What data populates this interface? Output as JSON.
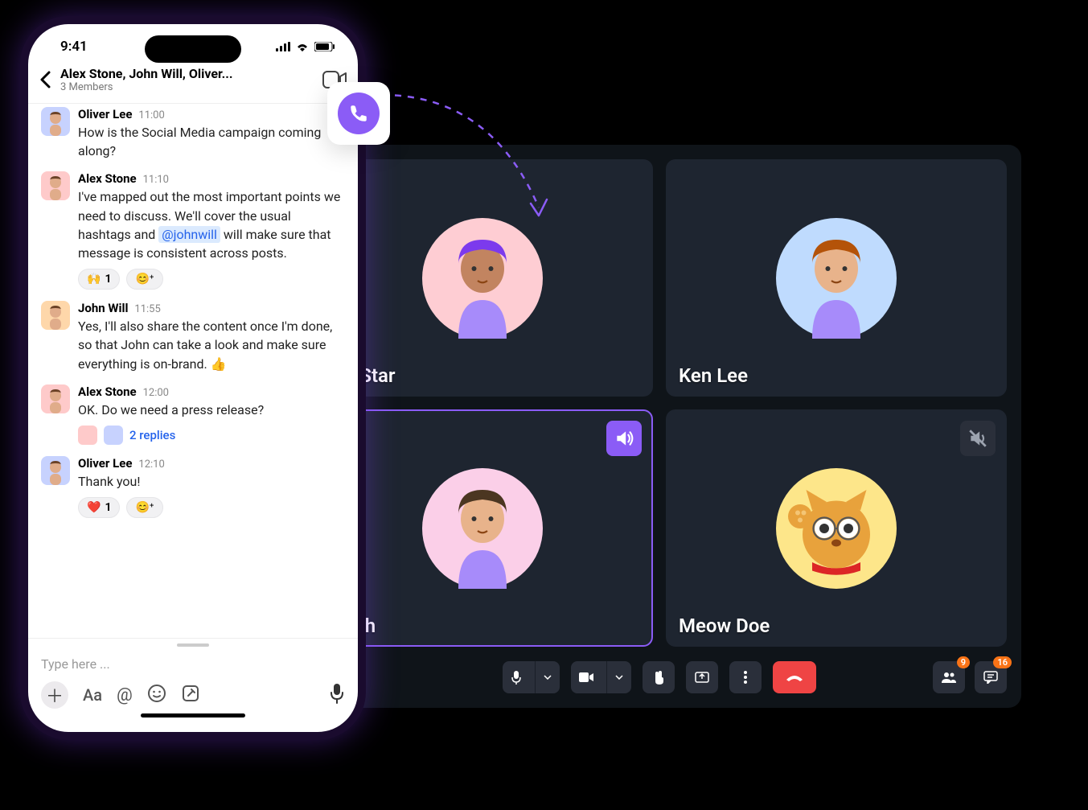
{
  "colors": {
    "accent": "#8b5cf6",
    "danger": "#ef4444",
    "badge": "#f97316"
  },
  "status": {
    "time": "9:41"
  },
  "chat": {
    "title": "Alex Stone, John Will, Oliver...",
    "subtitle": "3 Members",
    "composer_placeholder": "Type here ..."
  },
  "messages": [
    {
      "author": "Oliver Lee",
      "time": "11:00",
      "text": "How is the Social Media campaign coming along?",
      "avatar_bg": "#c7d2fe",
      "cut_top": true
    },
    {
      "author": "Alex Stone",
      "time": "11:10",
      "text_before": "I've mapped out the most important points we need to discuss. We'll cover the usual hashtags and ",
      "mention": "@johnwill",
      "text_after": " will make sure that message is consistent across posts.",
      "avatar_bg": "#fecaca",
      "reactions": [
        {
          "emoji": "🙌",
          "count": "1"
        },
        {
          "emoji": "😊⁺",
          "count": ""
        }
      ]
    },
    {
      "author": "John Will",
      "time": "11:55",
      "text": "Yes, I'll also share the content once I'm done, so that John can take a look and make sure everything is on-brand. 👍",
      "avatar_bg": "#fed7aa"
    },
    {
      "author": "Alex Stone",
      "time": "12:00",
      "text": "OK. Do we need a press release?",
      "avatar_bg": "#fecaca",
      "replies": {
        "count_label": "2 replies",
        "avatars": [
          "#fecaca",
          "#c7d2fe"
        ]
      }
    },
    {
      "author": "Oliver Lee",
      "time": "12:10",
      "text": "Thank you!",
      "avatar_bg": "#c7d2fe",
      "reactions": [
        {
          "emoji": "❤️",
          "count": "1"
        },
        {
          "emoji": "😊⁺",
          "count": ""
        }
      ]
    }
  ],
  "call": {
    "participants": [
      {
        "name": "aya Star",
        "visible_name": "aya Star",
        "avatar_bg": "#fecdd3",
        "hair": "#7c3aed",
        "skin": "#c28460"
      },
      {
        "name": "Ken Lee",
        "avatar_bg": "#bfdbfe",
        "hair": "#b45309",
        "skin": "#e8b38b"
      },
      {
        "name": "Smith",
        "visible_name": "Smith",
        "avatar_bg": "#fbcfe8",
        "hair": "#4b3621",
        "skin": "#e8b38b",
        "speaking": true,
        "badge": "speaker"
      },
      {
        "name": "Meow Doe",
        "avatar_bg": "#fde68a",
        "is_cat": true,
        "badge": "muted"
      }
    ],
    "badges": {
      "people": "9",
      "chat": "16"
    }
  }
}
